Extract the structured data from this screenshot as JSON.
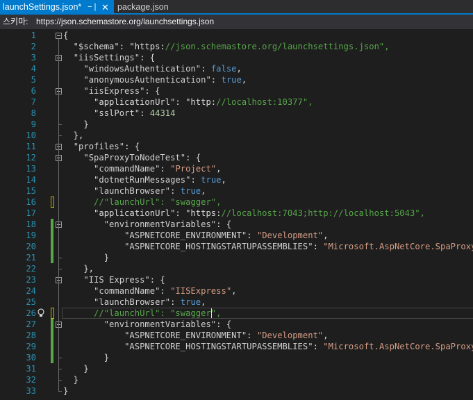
{
  "tabs": [
    {
      "label": "launchSettings.json*",
      "active": true,
      "pin_icon": "pin-icon",
      "close_icon": "close-icon"
    },
    {
      "label": "package.json",
      "active": false
    }
  ],
  "schema_bar": {
    "label": "스키마:",
    "url": "https://json.schemastore.org/launchsettings.json"
  },
  "editor": {
    "current_line": 26,
    "lines": [
      {
        "n": "1",
        "t": "{"
      },
      {
        "n": "2",
        "t": "  \"$schema\": \"https://json.schemastore.org/launchsettings.json\","
      },
      {
        "n": "3",
        "t": "  \"iisSettings\": {"
      },
      {
        "n": "4",
        "t": "    \"windowsAuthentication\": false,"
      },
      {
        "n": "5",
        "t": "    \"anonymousAuthentication\": true,"
      },
      {
        "n": "6",
        "t": "    \"iisExpress\": {"
      },
      {
        "n": "7",
        "t": "      \"applicationUrl\": \"http://localhost:10377\","
      },
      {
        "n": "8",
        "t": "      \"sslPort\": 44314"
      },
      {
        "n": "9",
        "t": "    }"
      },
      {
        "n": "10",
        "t": "  },"
      },
      {
        "n": "11",
        "t": "  \"profiles\": {"
      },
      {
        "n": "12",
        "t": "    \"SpaProxyToNodeTest\": {"
      },
      {
        "n": "13",
        "t": "      \"commandName\": \"Project\","
      },
      {
        "n": "14",
        "t": "      \"dotnetRunMessages\": true,"
      },
      {
        "n": "15",
        "t": "      \"launchBrowser\": true,"
      },
      {
        "n": "16",
        "t": "      //\"launchUrl\": \"swagger\","
      },
      {
        "n": "17",
        "t": "      \"applicationUrl\": \"https://localhost:7043;http://localhost:5043\","
      },
      {
        "n": "18",
        "t": "        \"environmentVariables\": {"
      },
      {
        "n": "19",
        "t": "            \"ASPNETCORE_ENVIRONMENT\": \"Development\","
      },
      {
        "n": "20",
        "t": "            \"ASPNETCORE_HOSTINGSTARTUPASSEMBLIES\": \"Microsoft.AspNetCore.SpaProxy\""
      },
      {
        "n": "21",
        "t": "        }"
      },
      {
        "n": "22",
        "t": "    },"
      },
      {
        "n": "23",
        "t": "    \"IIS Express\": {"
      },
      {
        "n": "24",
        "t": "      \"commandName\": \"IISExpress\","
      },
      {
        "n": "25",
        "t": "      \"launchBrowser\": true,"
      },
      {
        "n": "26",
        "t": "      //\"launchUrl\": \"swagger\","
      },
      {
        "n": "27",
        "t": "        \"environmentVariables\": {"
      },
      {
        "n": "28",
        "t": "            \"ASPNETCORE_ENVIRONMENT\": \"Development\","
      },
      {
        "n": "29",
        "t": "            \"ASPNETCORE_HOSTINGSTARTUPASSEMBLIES\": \"Microsoft.AspNetCore.SpaProxy\""
      },
      {
        "n": "30",
        "t": "        }"
      },
      {
        "n": "31",
        "t": "    }"
      },
      {
        "n": "32",
        "t": "  }"
      },
      {
        "n": "33",
        "t": "}"
      }
    ],
    "folds": [
      "1",
      "3",
      "6",
      "11",
      "12",
      "18",
      "23",
      "27"
    ],
    "changes_saved": [
      "18",
      "19",
      "20",
      "21",
      "27",
      "28",
      "29",
      "30"
    ],
    "changes_unsaved": [
      "16",
      "26"
    ]
  },
  "colors": {
    "accent": "#007acc",
    "background": "#1e1e1e",
    "line_number": "#2b91af",
    "string": "#d69d85",
    "keyword": "#569cd6",
    "number": "#b5cea8",
    "comment": "#57a64a"
  }
}
